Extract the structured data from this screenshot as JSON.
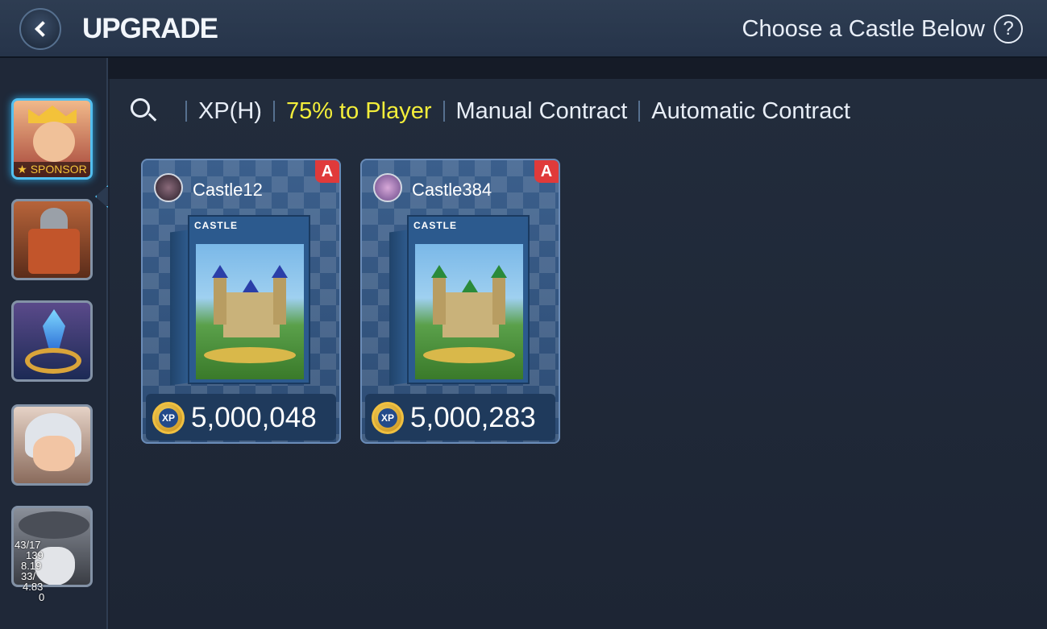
{
  "header": {
    "title": "UPGRADE",
    "hint": "Choose a Castle Below",
    "help": "?"
  },
  "sidebar": {
    "items": [
      {
        "icon": "king-avatar-icon",
        "label": "SPONSOR"
      },
      {
        "icon": "cannon-tower-icon"
      },
      {
        "icon": "crystal-tower-icon"
      },
      {
        "icon": "knight-avatar-icon"
      },
      {
        "icon": "wizard-avatar-icon"
      }
    ],
    "overlay_numbers": [
      "43/17",
      "139",
      "8.19",
      "33/",
      "4.83",
      "0"
    ]
  },
  "filters": {
    "items": [
      "XP(H)",
      "75% to Player",
      "Manual Contract",
      "Automatic Contract"
    ],
    "highlight_color": "#f3ee3a"
  },
  "cards": [
    {
      "name": "Castle12",
      "badge": "A",
      "box_label": "CASTLE",
      "xp_symbol": "XP",
      "price": "5,000,048",
      "roof": "blue"
    },
    {
      "name": "Castle384",
      "badge": "A",
      "box_label": "CASTLE",
      "xp_symbol": "XP",
      "price": "5,000,283",
      "roof": "green"
    }
  ]
}
